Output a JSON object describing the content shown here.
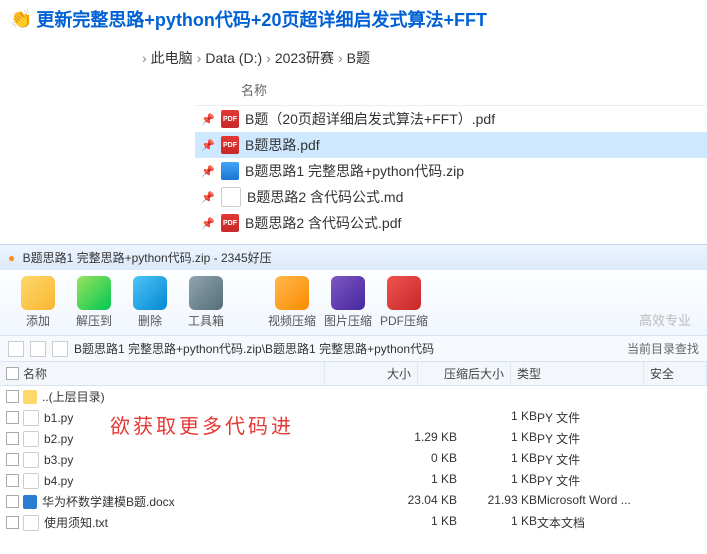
{
  "title": "更新完整思路+python代码+20页超详细启发式算法+FFT",
  "hands_icon": "👏",
  "breadcrumb": [
    "此电脑",
    "Data (D:)",
    "2023研赛",
    "B题"
  ],
  "name_header": "名称",
  "files": [
    {
      "name": "B题（20页超详细启发式算法+FFT）.pdf",
      "icon": "pdf",
      "selected": false
    },
    {
      "name": "B题思路.pdf",
      "icon": "pdf",
      "selected": true
    },
    {
      "name": "B题思路1 完整思路+python代码.zip",
      "icon": "zip",
      "selected": false
    },
    {
      "name": "B题思路2 含代码公式.md",
      "icon": "md",
      "selected": false
    },
    {
      "name": "B题思路2 含代码公式.pdf",
      "icon": "pdf",
      "selected": false
    }
  ],
  "app_title": "B题思路1 完整思路+python代码.zip - 2345好压",
  "toolbar": {
    "add": "添加",
    "extract": "解压到",
    "delete": "删除",
    "toolbox": "工具箱",
    "video": "视频压缩",
    "image": "图片压缩",
    "pdf": "PDF压缩",
    "right": "高效专业"
  },
  "path": "B题思路1 完整思路+python代码.zip\\B题思路1 完整思路+python代码",
  "path_right": "当前目录查找",
  "columns": {
    "name": "名称",
    "size": "大小",
    "compressed": "压缩后大小",
    "type": "类型",
    "security": "安全"
  },
  "overlay_text": "欲获取更多代码进",
  "rows": [
    {
      "name": "..(上层目录)",
      "icon": "folder",
      "size": "",
      "comp": "",
      "type": ""
    },
    {
      "name": "b1.py",
      "icon": "py",
      "size": "",
      "comp": "1 KB",
      "type": "PY 文件"
    },
    {
      "name": "b2.py",
      "icon": "py",
      "size": "1.29 KB",
      "comp": "1 KB",
      "type": "PY 文件"
    },
    {
      "name": "b3.py",
      "icon": "py",
      "size": "0 KB",
      "comp": "1 KB",
      "type": "PY 文件"
    },
    {
      "name": "b4.py",
      "icon": "py",
      "size": "1 KB",
      "comp": "1 KB",
      "type": "PY 文件"
    },
    {
      "name": "华为杯数学建模B题.docx",
      "icon": "doc",
      "size": "23.04 KB",
      "comp": "21.93 KB",
      "type": "Microsoft Word ..."
    },
    {
      "name": "使用须知.txt",
      "icon": "txt",
      "size": "1 KB",
      "comp": "1 KB",
      "type": "文本文档"
    }
  ]
}
